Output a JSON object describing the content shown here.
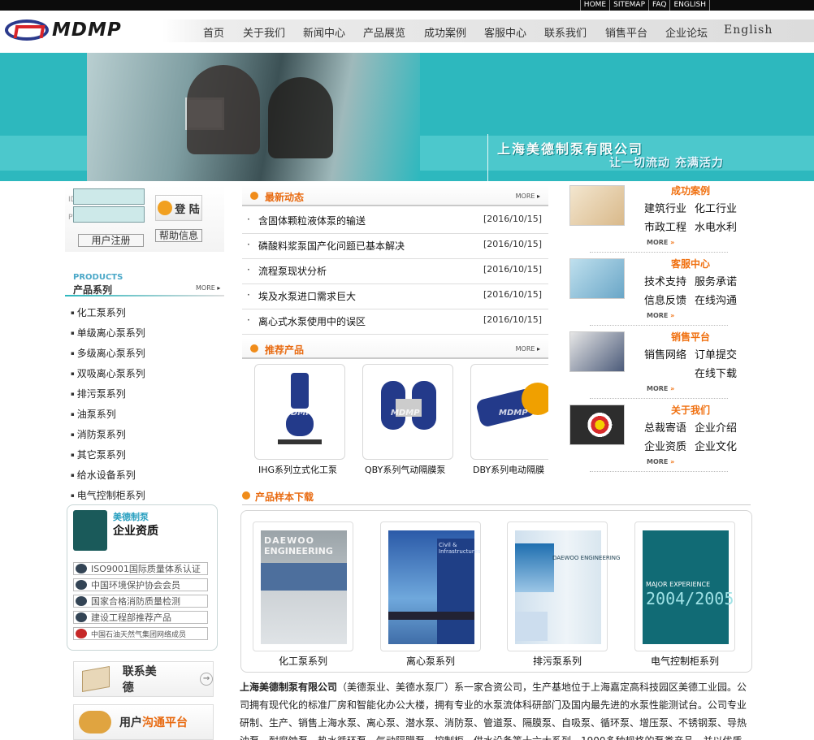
{
  "top_links": [
    "HOME",
    "SITEMAP",
    "FAQ",
    "ENGLISH"
  ],
  "logo": {
    "text": "MDMP"
  },
  "nav": [
    "首页",
    "关于我们",
    "新闻中心",
    "产品展览",
    "成功案例",
    "客服中心",
    "联系我们",
    "销售平台",
    "企业论坛",
    "English"
  ],
  "banner": {
    "company": "上海美德制泵有限公司",
    "slogan": "让一切流动 充满活力"
  },
  "login": {
    "id_label": "ID",
    "pw_label": "PW",
    "login_btn": "登 陆",
    "register_btn": "用户注册",
    "help_btn": "帮助信息"
  },
  "products_section": {
    "en": "PRODUCTS",
    "title": "产品系列",
    "more": "MORE"
  },
  "categories": [
    "化工泵系列",
    "单级离心泵系列",
    "多级离心泵系列",
    "双吸离心泵系列",
    "排污泵系列",
    "油泵系列",
    "消防泵系列",
    "其它泵系列",
    "给水设备系列",
    "电气控制柜系列"
  ],
  "qualifications": {
    "brand": "美德制泵",
    "title": "企业资质",
    "items": [
      "ISO9001国际质量体系认证",
      "中国环境保护协会会员",
      "国家合格消防质量检测",
      "建设工程部推荐产品",
      "中国石油天然气集团网络成员"
    ]
  },
  "contact_card": {
    "label": "联系美德"
  },
  "platform_card": {
    "label_a": "用户",
    "label_b": "沟通平台"
  },
  "news": {
    "title": "最新动态",
    "more": "MORE",
    "items": [
      {
        "title": "含固体颗粒液体泵的输送",
        "date": "[2016/10/15]"
      },
      {
        "title": "磷酸料浆泵国产化问题已基本解决",
        "date": "[2016/10/15]"
      },
      {
        "title": "流程泵现状分析",
        "date": "[2016/10/15]"
      },
      {
        "title": "埃及水泵进口需求巨大",
        "date": "[2016/10/15]"
      },
      {
        "title": "离心式水泵使用中的误区",
        "date": "[2016/10/15]"
      }
    ]
  },
  "featured": {
    "title": "推荐产品",
    "more": "MORE",
    "watermark": "MDMP",
    "items": [
      "IHG系列立式化工泵",
      "QBY系列气动隔膜泵",
      "DBY系列电动隔膜"
    ]
  },
  "right_sections": [
    {
      "title": "成功案例",
      "links": [
        "建筑行业",
        "化工行业",
        "市政工程",
        "水电水利"
      ],
      "more": "MORE"
    },
    {
      "title": "客服中心",
      "links": [
        "技术支持",
        "服务承诺",
        "信息反馈",
        "在线沟通"
      ],
      "more": "MORE"
    },
    {
      "title": "销售平台",
      "links": [
        "销售网络",
        "订单提交",
        "在线下载"
      ],
      "more": "MORE"
    },
    {
      "title": "关于我们",
      "links": [
        "总裁寄语",
        "企业介绍",
        "企业资质",
        "企业文化"
      ],
      "more": "MORE"
    }
  ],
  "downloads": {
    "title": "产品样本下载",
    "items": [
      {
        "caption": "化工泵系列",
        "cover_line1": "DAEWOO",
        "cover_line2": "ENGINEERING"
      },
      {
        "caption": "离心泵系列",
        "cover_line1": "Civil &",
        "cover_line2": "Infrastructures"
      },
      {
        "caption": "排污泵系列",
        "cover_line1": "DAEWOO ENGINEERING",
        "cover_line2": ""
      },
      {
        "caption": "电气控制柜系列",
        "cover_line1": "MAJOR EXPERIENCE",
        "cover_line2": "2004/2005"
      }
    ]
  },
  "intro": {
    "company": "上海美德制泵有限公司",
    "text": "（美德泵业、美德水泵厂）系一家合资公司，生产基地位于上海嘉定高科技园区美德工业园。公司拥有现代化的标准厂房和智能化办公大楼，拥有专业的水泵流体科研部门及国内最先进的水泵性能测试台。公司专业研制、生产、销售上海水泵、离心泵、潜水泵、消防泵、管道泵、隔膜泵、自吸泵、循环泵、增压泵、不锈钢泵、导热油泵、耐腐蚀泵、热水循环泵、气动隔膜泵、控制柜、供水设备等十六大系列，1900多种规格的泵类产品。并以优质"
  },
  "colors": {
    "teal": "#2db8be",
    "orange": "#e86a10",
    "navy": "#233a8a"
  }
}
